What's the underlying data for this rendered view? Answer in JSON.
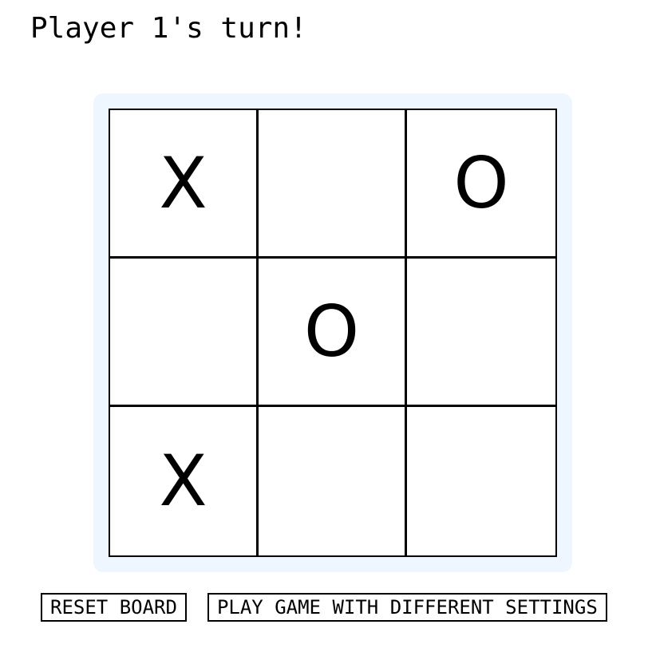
{
  "status": "Player 1's turn!",
  "board": {
    "cells": [
      "X",
      "",
      "O",
      "",
      "O",
      "",
      "X",
      "",
      ""
    ]
  },
  "controls": {
    "reset_label": "RESET BOARD",
    "settings_label": "PLAY GAME WITH DIFFERENT SETTINGS"
  },
  "colors": {
    "board_frame": "#eef6ff",
    "grid_lines": "#000000",
    "background": "#ffffff"
  }
}
